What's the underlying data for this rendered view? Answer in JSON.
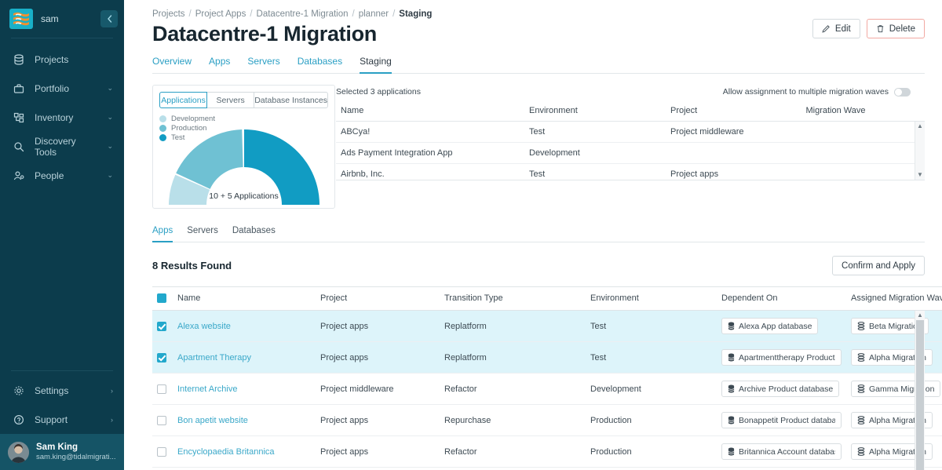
{
  "sidebar": {
    "brand": "sam",
    "collapse_icon": "chevron-left-icon",
    "items": [
      {
        "label": "Projects",
        "icon": "projects-icon",
        "chevron": ""
      },
      {
        "label": "Portfolio",
        "icon": "briefcase-icon",
        "chevron": "⌄"
      },
      {
        "label": "Inventory",
        "icon": "inventory-icon",
        "chevron": "⌄"
      },
      {
        "label": "Discovery Tools",
        "icon": "search-icon",
        "chevron": "⌄"
      },
      {
        "label": "People",
        "icon": "people-icon",
        "chevron": "⌄"
      }
    ],
    "footer_items": [
      {
        "label": "Settings",
        "icon": "gear-icon",
        "chevron": "›"
      },
      {
        "label": "Support",
        "icon": "help-circle-icon",
        "chevron": "›"
      }
    ],
    "user": {
      "name": "Sam King",
      "email": "sam.king@tidalmigrati..."
    }
  },
  "header": {
    "breadcrumb": [
      {
        "label": "Projects",
        "active": false
      },
      {
        "label": "Project Apps",
        "active": false
      },
      {
        "label": "Datacentre-1 Migration",
        "active": false
      },
      {
        "label": "planner",
        "active": false
      },
      {
        "label": "Staging",
        "active": true
      }
    ],
    "separator": "/",
    "title": "Datacentre-1 Migration",
    "edit_label": "Edit",
    "delete_label": "Delete",
    "tabs": [
      {
        "label": "Overview",
        "active": false
      },
      {
        "label": "Apps",
        "active": false
      },
      {
        "label": "Servers",
        "active": false
      },
      {
        "label": "Databases",
        "active": false
      },
      {
        "label": "Staging",
        "active": true
      }
    ]
  },
  "chart_panel": {
    "segments": [
      {
        "label": "Applications",
        "active": true
      },
      {
        "label": "Servers",
        "active": false
      },
      {
        "label": "Database Instances",
        "active": false
      }
    ],
    "center_label": "10 + 5 Applications"
  },
  "chart_data": {
    "type": "pie",
    "subtype": "half-donut",
    "title": "",
    "categories": [
      "Development",
      "Production",
      "Test"
    ],
    "values": [
      2,
      3,
      5
    ],
    "colors": [
      "#b9dfe9",
      "#6fc1d3",
      "#119cc3"
    ],
    "center_label": "10 + 5 Applications",
    "legend_position": "top-left",
    "total": 10
  },
  "selected_panel": {
    "count_text": "Selected 3 applications",
    "toggle_label": "Allow assignment to multiple migration waves",
    "toggle_on": false,
    "columns": [
      "Name",
      "Environment",
      "Project",
      "Migration Wave"
    ],
    "rows": [
      {
        "name": "ABCya!",
        "environment": "Test",
        "project": "Project middleware",
        "wave": ""
      },
      {
        "name": "Ads Payment Integration App",
        "environment": "Development",
        "project": "",
        "wave": ""
      },
      {
        "name": "Airbnb, Inc.",
        "environment": "Test",
        "project": "Project apps",
        "wave": ""
      }
    ]
  },
  "lower": {
    "subtabs": [
      {
        "label": "Apps",
        "active": true
      },
      {
        "label": "Servers",
        "active": false
      },
      {
        "label": "Databases",
        "active": false
      }
    ],
    "results_text": "8 Results Found",
    "confirm_label": "Confirm and Apply",
    "columns": [
      "Name",
      "Project",
      "Transition Type",
      "Environment",
      "Dependent On",
      "Assigned Migration Waves"
    ],
    "header_checkbox_state": "indeterminate",
    "rows": [
      {
        "selected": true,
        "name": "Alexa website",
        "project": "Project apps",
        "transition": "Replatform",
        "environment": "Test",
        "dependent_on": "Alexa App database",
        "wave": "Beta Migration"
      },
      {
        "selected": true,
        "name": "Apartment Therapy",
        "project": "Project apps",
        "transition": "Replatform",
        "environment": "Test",
        "dependent_on": "Apartmenttherapy Product data",
        "wave": "Alpha Migration"
      },
      {
        "selected": false,
        "name": "Internet Archive",
        "project": "Project middleware",
        "transition": "Refactor",
        "environment": "Development",
        "dependent_on": "Archive Product database",
        "wave": "Gamma Migration"
      },
      {
        "selected": false,
        "name": "Bon apetit website",
        "project": "Project apps",
        "transition": "Repurchase",
        "environment": "Production",
        "dependent_on": "Bonappetit Product database",
        "wave": "Alpha Migration"
      },
      {
        "selected": false,
        "name": "Encyclopaedia Britannica",
        "project": "Project apps",
        "transition": "Refactor",
        "environment": "Production",
        "dependent_on": "Britannica Account database",
        "wave": "Alpha Migration"
      }
    ]
  },
  "colors": {
    "sidebar_bg": "#0c3c4c",
    "accent": "#2a9fc4",
    "selected_row": "#ddf4fa",
    "danger_border": "#f2a9a2",
    "logo_bg": "#19b0c8",
    "logo_stripe": "#f0912f"
  }
}
